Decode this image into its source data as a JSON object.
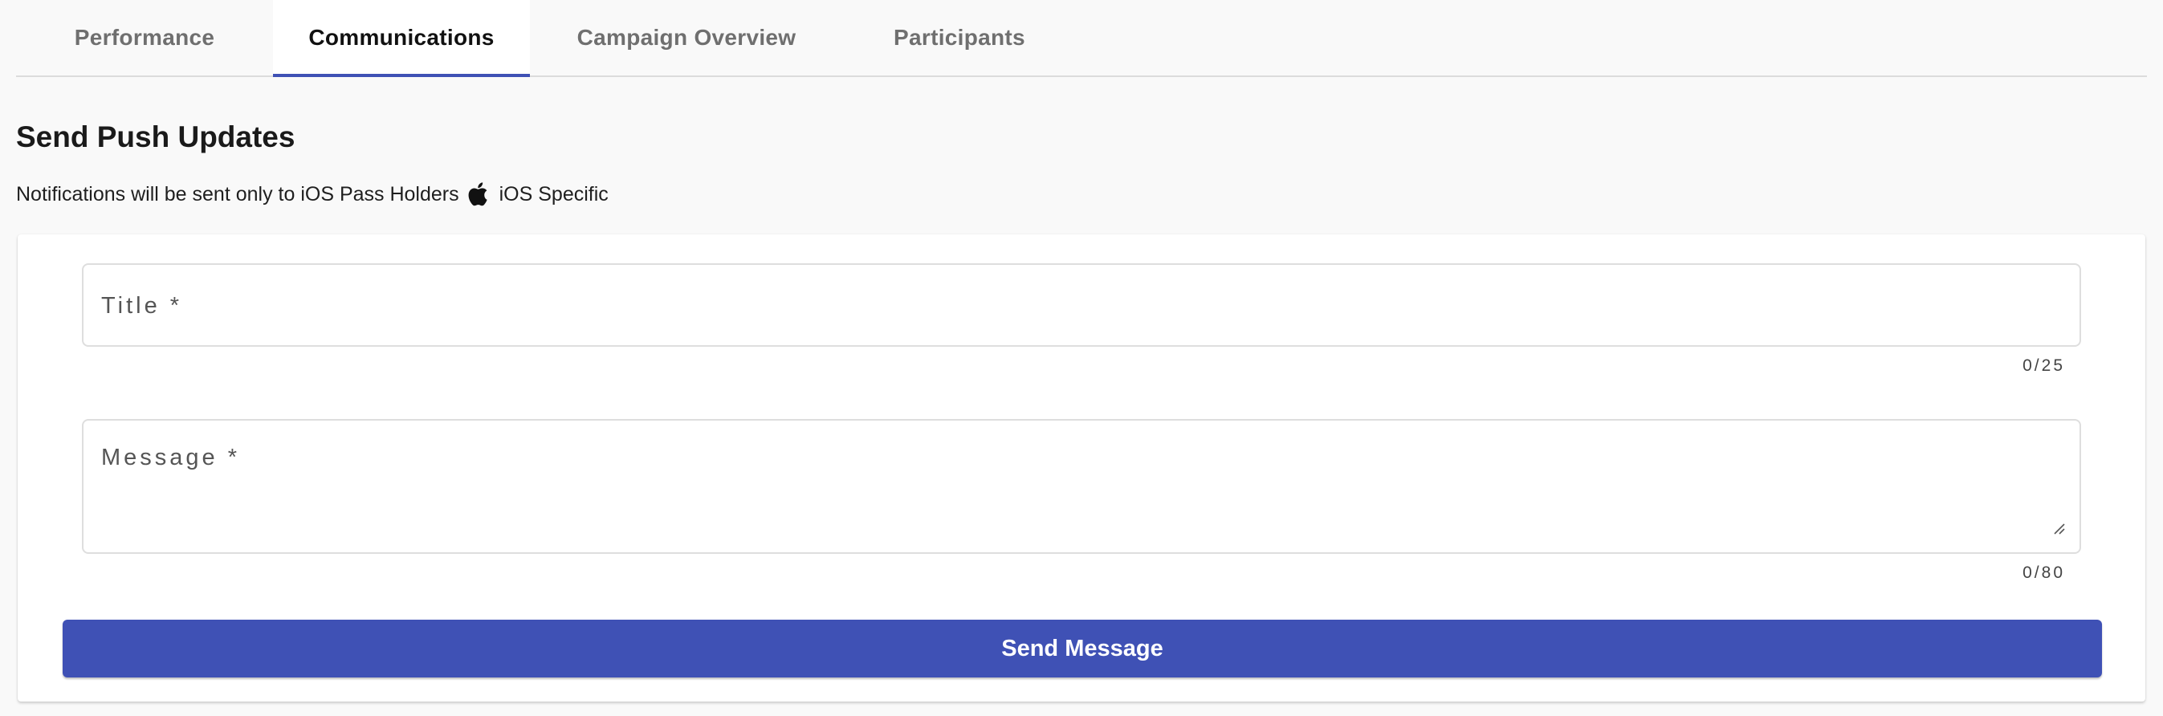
{
  "tabs": [
    {
      "label": "Performance",
      "active": false
    },
    {
      "label": "Communications",
      "active": true
    },
    {
      "label": "Campaign Overview",
      "active": false
    },
    {
      "label": "Participants",
      "active": false
    }
  ],
  "heading": "Send Push Updates",
  "notice": {
    "text": "Notifications will be sent only to iOS Pass Holders",
    "icon": "apple-icon",
    "tag": "iOS Specific"
  },
  "form": {
    "title": {
      "placeholder": "Title *",
      "value": "",
      "counter": "0/25"
    },
    "message": {
      "placeholder": "Message *",
      "value": "",
      "counter": "0/80"
    },
    "submit_label": "Send Message"
  },
  "colors": {
    "accent": "#3f51b5",
    "background": "#f9f9f9",
    "card": "#ffffff"
  }
}
